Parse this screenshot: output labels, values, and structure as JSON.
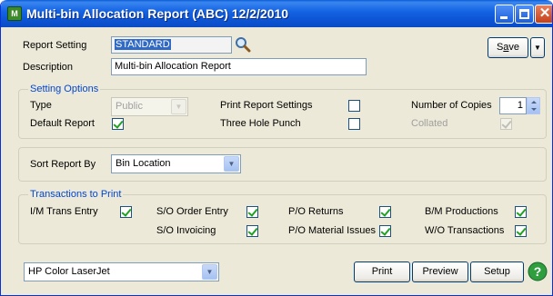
{
  "window": {
    "title": "Multi-bin Allocation Report (ABC) 12/2/2010",
    "app_icon": "report-app-icon",
    "controls": [
      "minimize-icon",
      "maximize-icon",
      "close-icon"
    ]
  },
  "header": {
    "report_setting_label": "Report Setting",
    "report_setting_value": "STANDARD",
    "description_label": "Description",
    "description_value": "Multi-bin Allocation Report",
    "save_label": "Save",
    "save_mnemonic_prefix": "S",
    "save_mnemonic": "a",
    "save_mnemonic_suffix": "ve"
  },
  "setting_options": {
    "title": "Setting Options",
    "type_label": "Type",
    "type_value": "Public",
    "default_report_label": "Default Report",
    "default_report_checked": true,
    "print_report_settings_label": "Print Report Settings",
    "print_report_settings_checked": false,
    "three_hole_punch_label": "Three Hole Punch",
    "three_hole_punch_checked": false,
    "number_of_copies_label": "Number of Copies",
    "number_of_copies_value": "1",
    "collated_label": "Collated",
    "collated_checked": true
  },
  "sort": {
    "label": "Sort Report By",
    "value": "Bin Location"
  },
  "transactions": {
    "title": "Transactions to Print",
    "items": [
      {
        "label": "I/M Trans Entry",
        "checked": true
      },
      {
        "label": "S/O Order Entry",
        "checked": true
      },
      {
        "label": "P/O Returns",
        "checked": true
      },
      {
        "label": "B/M Productions",
        "checked": true
      },
      {
        "label": "S/O Invoicing",
        "checked": true
      },
      {
        "label": "P/O Material Issues",
        "checked": true
      },
      {
        "label": "W/O Transactions",
        "checked": true
      }
    ]
  },
  "footer": {
    "printer_value": "HP Color LaserJet",
    "print_label": "Print",
    "preview_label": "Preview",
    "setup_label": "Setup",
    "help_icon": "help-icon"
  },
  "colors": {
    "titlebar": "#0A5BD6",
    "group_title": "#0046D5",
    "checkmark": "#21A121",
    "selection": "#316AC5"
  }
}
